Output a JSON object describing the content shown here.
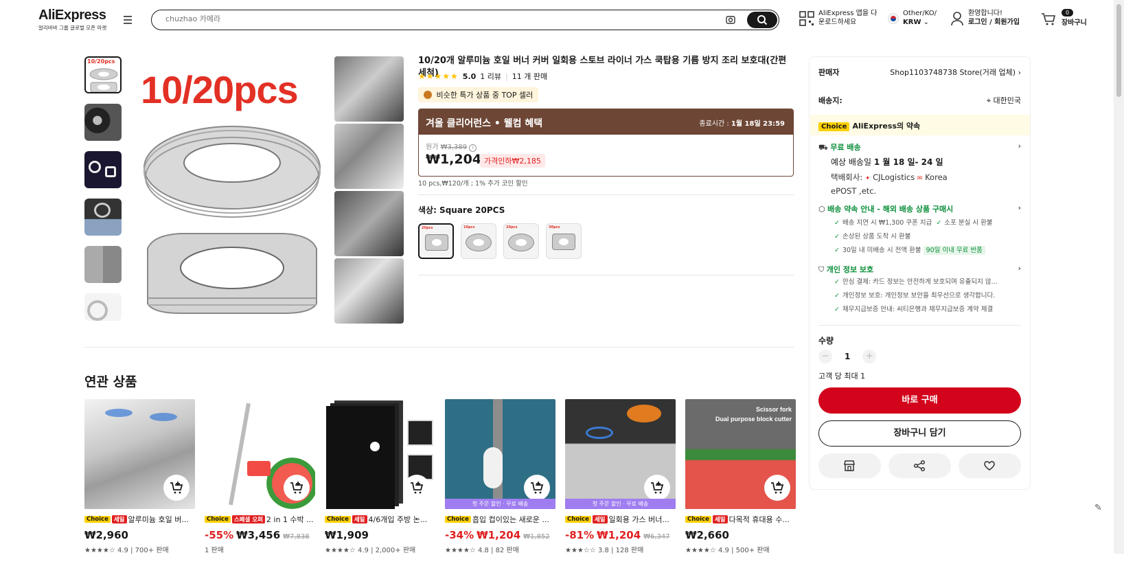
{
  "header": {
    "logo": "AliExpress",
    "logo_sub": "알리바바 그룹 글로벌 오픈 마켓",
    "search_placeholder": "chuzhao 카메라",
    "app_line1": "AliExpress 앱을 다",
    "app_line2": "운로드하세요",
    "region_line1": "Other/KO/",
    "region_line2": "KRW",
    "account_line1": "환영합니다!",
    "account_line2": "로그인 / 회원가입",
    "cart_count": "0",
    "cart_label": "장바구니"
  },
  "product": {
    "title": "10/20개 알루미늄 호일 버너 커버 일회용 스토브 라이너 가스 쿡탑용 기름 방지 조리 보호대(간편 세척)",
    "rating": "5.0",
    "reviews": "1 리뷰",
    "sold": "11 개 판매",
    "top_seller": "비슷한 특가 상품 중 TOP 셀러",
    "image_text": "10/20pcs",
    "thumb_label": "10/20pcs",
    "promo_title": "겨울 클리어런스 • 웰컴 혜택",
    "promo_end_label": "종료시간 :",
    "promo_end": "1월 18일 23:59",
    "orig_label": "원가",
    "orig_price": "₩3,389",
    "price": "₩1,204",
    "discount": "가격인하₩2,185",
    "unit_info": "10 pcs,₩120/개 ; 1% 추가 코인 할인",
    "color_label": "색상: Square 20PCS",
    "swatch_labels": [
      "20pcs",
      "10pcs",
      "20pcs",
      "30pcs"
    ]
  },
  "panel": {
    "seller_label": "판매자",
    "seller_name": "Shop1103748738 Store(거래 업체)",
    "ship_to_label": "배송지:",
    "ship_to": "대한민국",
    "choice_tag": "Choice",
    "choice_promise": "AliExpress의 약속",
    "free_shipping": "무료 배송",
    "delivery_prefix": "예상 배송일",
    "delivery_dates": "1 월 18 일- 24 일",
    "courier_label": "택배회사:",
    "courier1": "CJLogistics",
    "courier2": "Korea",
    "courier3": "ePOST ,etc.",
    "delivery_promise": "배송 약속 안내 - 해외 배송 상품 구매시",
    "dp1": "배송 지연 시 ₩1,300 쿠폰 지급",
    "dp2": "소포 분실 시 환불",
    "dp3": "손상된 상품 도착 시 환불",
    "dp4": "30일 내 미배송 시 전액 환불",
    "dp4_tag": "90일 이내 무료 반품",
    "privacy": "개인 정보 보호",
    "pv1": "안심 결제: 카드 정보는 안전하게 보호되며 유출되지 않...",
    "pv2": "개인정보 보호: 개인정보 보안을 최우선으로 생각합니다.",
    "pv3": "채무지급보증 안내: 씨티은행과 채무지급보증 계약 체결",
    "qty_label": "수량",
    "qty_value": "1",
    "qty_limit": "고객 당 최대 1",
    "buy_now": "바로 구매",
    "add_to_cart": "장바구니 담기"
  },
  "related": {
    "title": "연관 상품",
    "items": [
      {
        "choice": "Choice",
        "tag": "세일",
        "name": "알루미늄 호일 버...",
        "disc": "",
        "price": "₩2,960",
        "orig": "",
        "sold": "★★★★☆ 4.9 | 700+ 판매",
        "ribbon": ""
      },
      {
        "choice": "Choice",
        "tag": "스페셜 오퍼",
        "name": "2 in 1 수박 ...",
        "disc": "-55%",
        "price": "₩3,456",
        "orig": "₩7,838",
        "sold": "1 판매",
        "ribbon": ""
      },
      {
        "choice": "Choice",
        "tag": "세일",
        "name": "4/6개입 주방 논...",
        "disc": "",
        "price": "₩1,909",
        "orig": "",
        "sold": "★★★★☆ 4.9 | 2,000+ 판매",
        "ribbon": ""
      },
      {
        "choice": "Choice",
        "tag": "",
        "name": "흡입 컵이있는 새로운 ...",
        "disc": "-34%",
        "price": "₩1,204",
        "orig": "₩1,852",
        "sold": "★★★★☆ 4.8 | 82 판매",
        "ribbon": "첫 주문 할인 · 무료 배송"
      },
      {
        "choice": "Choice",
        "tag": "세일",
        "name": "일회용 가스 버너...",
        "disc": "-81%",
        "price": "₩1,204",
        "orig": "₩6,347",
        "sold": "★★★☆☆ 3.8 | 128 판매",
        "ribbon": "첫 주문 할인 · 무료 배송"
      },
      {
        "choice": "Choice",
        "tag": "세일",
        "name": "다목적 휴대용 수...",
        "disc": "",
        "price": "₩2,660",
        "orig": "",
        "sold": "★★★★☆ 4.9 | 500+ 판매",
        "ribbon": ""
      }
    ],
    "card6_overlay1": "Scissor fork",
    "card6_overlay2": "Dual purpose block cutter"
  },
  "colors": {
    "brand_red": "#d3031c",
    "promo_brown": "#6d4635",
    "choice_yellow": "#fdd000",
    "green": "#0b8f3a"
  }
}
